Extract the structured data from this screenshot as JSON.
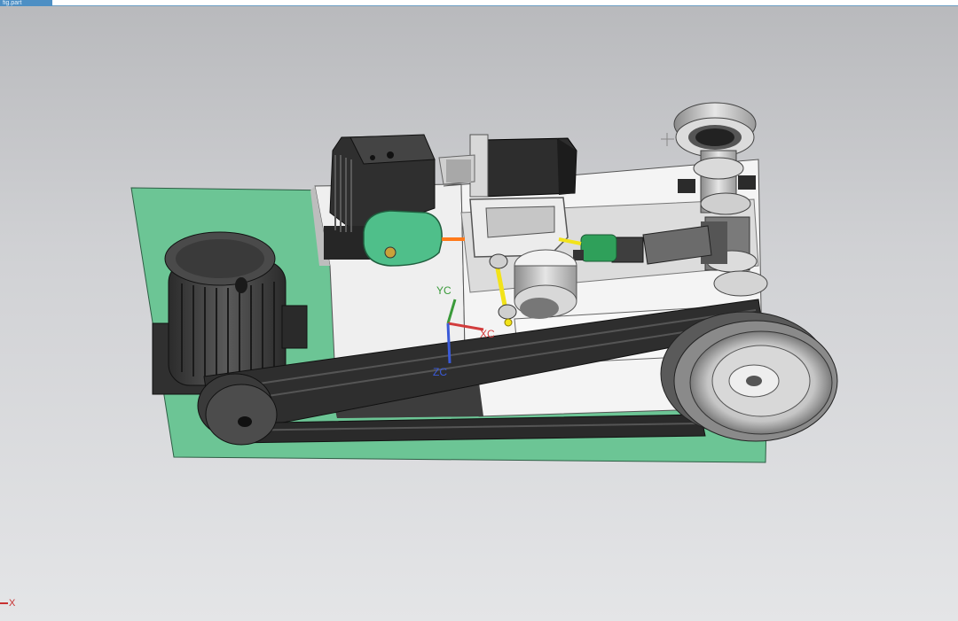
{
  "window": {
    "tab_label": "fig.part"
  },
  "viewport": {
    "background_top": "#b8b9bc",
    "background_bottom": "#e4e5e7",
    "model": {
      "base_plate_color": "#6cc595",
      "motor_color": "#3a3a3a",
      "belt_color": "#2e2e2e",
      "guard_color": "#4fbf8a",
      "coupling_color": "#2fa05a",
      "shaft_highlight": "#f2e31a"
    },
    "wcs": {
      "x_label": "XC",
      "y_label": "YC",
      "z_label": "ZC",
      "x_color": "#d23c3c",
      "y_color": "#3a9a3a",
      "z_color": "#3a5ad8"
    },
    "absolute_axis": {
      "x_label": "X"
    }
  }
}
